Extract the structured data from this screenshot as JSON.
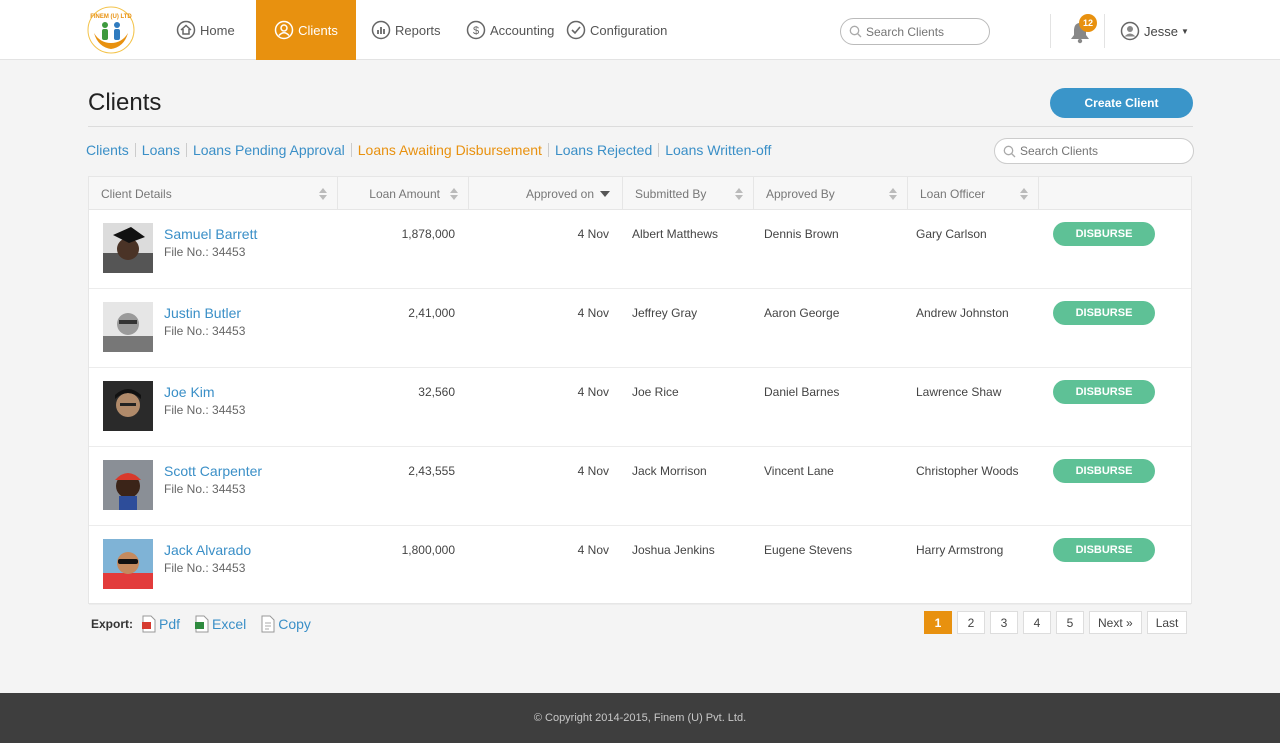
{
  "brand": {
    "logo_text": "FINEM (U) LTD",
    "accent": "#e8910f",
    "link": "#3a8fc7",
    "success": "#5ec196"
  },
  "nav": {
    "home": "Home",
    "clients": "Clients",
    "reports": "Reports",
    "accounting": "Accounting",
    "configuration": "Configuration",
    "search_placeholder": "Search Clients",
    "notifications_count": "12",
    "user_name": "Jesse"
  },
  "page": {
    "title": "Clients",
    "create_label": "Create Client"
  },
  "subnav": {
    "items": [
      "Clients",
      "Loans",
      "Loans Pending Approval",
      "Loans Awaiting Disbursement",
      "Loans Rejected",
      "Loans Written-off"
    ],
    "active": "Loans Awaiting Disbursement",
    "search_placeholder": "Search Clients"
  },
  "table": {
    "headers": [
      "Client Details",
      "Loan Amount",
      "Approved on",
      "Submitted By",
      "Approved By",
      "Loan Officer"
    ],
    "action_label": "DISBURSE",
    "file_prefix": "File No.:",
    "rows": [
      {
        "name": "Samuel Barrett",
        "file": "34453",
        "amount": "1,878,000",
        "approved_on": "4 Nov",
        "submitted_by": "Albert Matthews",
        "approved_by": "Dennis Brown",
        "officer": "Gary Carlson"
      },
      {
        "name": "Justin Butler",
        "file": "34453",
        "amount": "2,41,000",
        "approved_on": "4 Nov",
        "submitted_by": "Jeffrey Gray",
        "approved_by": "Aaron George",
        "officer": "Andrew Johnston"
      },
      {
        "name": "Joe Kim",
        "file": "34453",
        "amount": "32,560",
        "approved_on": "4 Nov",
        "submitted_by": "Joe Rice",
        "approved_by": "Daniel Barnes",
        "officer": "Lawrence Shaw"
      },
      {
        "name": "Scott Carpenter",
        "file": "34453",
        "amount": "2,43,555",
        "approved_on": "4 Nov",
        "submitted_by": "Jack Morrison",
        "approved_by": "Vincent Lane",
        "officer": "Christopher Woods"
      },
      {
        "name": "Jack Alvarado",
        "file": "34453",
        "amount": "1,800,000",
        "approved_on": "4 Nov",
        "submitted_by": "Joshua Jenkins",
        "approved_by": "Eugene Stevens",
        "officer": "Harry Armstrong"
      }
    ]
  },
  "export": {
    "label": "Export:",
    "pdf": "Pdf",
    "excel": "Excel",
    "copy": "Copy"
  },
  "pagination": {
    "pages": [
      "1",
      "2",
      "3",
      "4",
      "5"
    ],
    "current": "1",
    "next": "Next »",
    "last": "Last"
  },
  "footer": {
    "copyright": "© Copyright 2014-2015, Finem (U) Pvt. Ltd."
  }
}
